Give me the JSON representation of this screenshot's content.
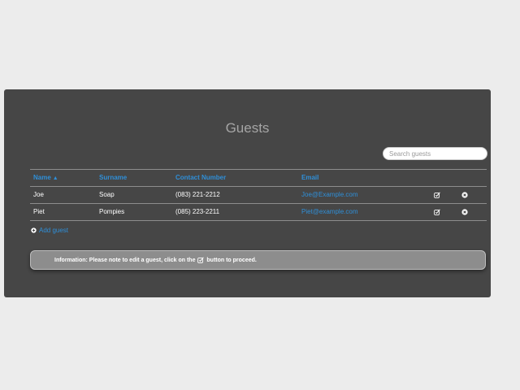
{
  "page": {
    "title": "Guests"
  },
  "search": {
    "placeholder": "Search guests"
  },
  "table": {
    "columns": {
      "name": "Name",
      "surname": "Surname",
      "contact": "Contact Number",
      "email": "Email"
    },
    "sort_indicator": "▲",
    "rows": [
      {
        "name": "Joe",
        "surname": "Soap",
        "contact": "(083) 221-2212",
        "email": "Joe@Example.com"
      },
      {
        "name": "Piet",
        "surname": "Pompies",
        "contact": "(085) 223-2211",
        "email": "Piet@example.com"
      }
    ]
  },
  "actions": {
    "add_guest_label": "Add guest"
  },
  "info": {
    "text_before": "Information: Please note to edit a guest, click on the",
    "text_after": "button to proceed."
  },
  "colors": {
    "panel_bg": "#464646",
    "page_bg": "#ececec",
    "accent": "#2f8fd8",
    "info_bg": "#8d8d8d"
  },
  "icons": {
    "edit": "edit-icon",
    "remove": "remove-icon",
    "add": "add-icon"
  }
}
